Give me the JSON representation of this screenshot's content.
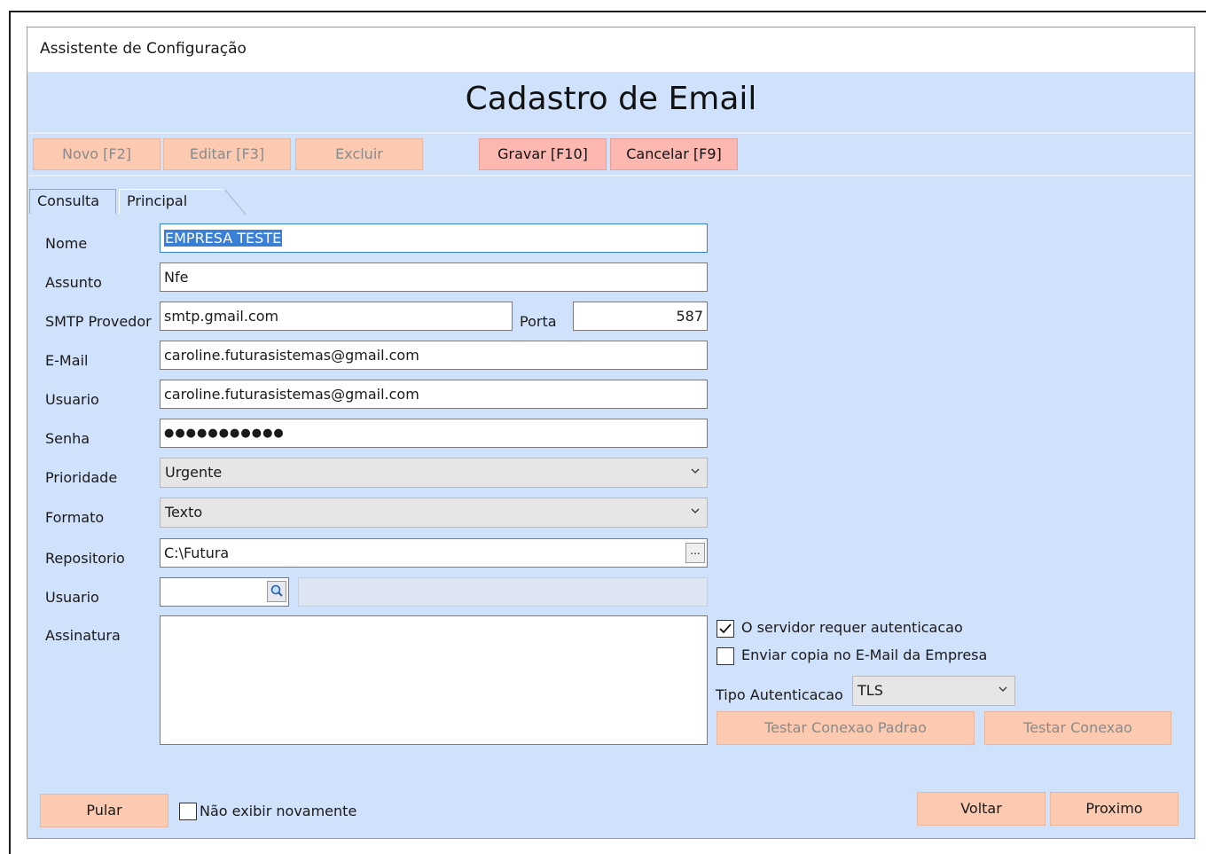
{
  "window": {
    "title": "Assistente de Configuração",
    "heading": "Cadastro de Email"
  },
  "toolbar": {
    "novo": "Novo [F2]",
    "editar": "Editar [F3]",
    "excluir": "Excluir",
    "gravar": "Gravar [F10]",
    "cancelar": "Cancelar [F9]"
  },
  "tabs": [
    "Consulta",
    "Principal"
  ],
  "form": {
    "nome": {
      "label": "Nome",
      "value": "EMPRESA TESTE"
    },
    "assunto": {
      "label": "Assunto",
      "value": "Nfe"
    },
    "smtp": {
      "label": "SMTP Provedor",
      "value": "smtp.gmail.com"
    },
    "porta": {
      "label": "Porta",
      "value": "587"
    },
    "email": {
      "label": "E-Mail",
      "value": "caroline.futurasistemas@gmail.com"
    },
    "usuario": {
      "label": "Usuario",
      "value": "caroline.futurasistemas@gmail.com"
    },
    "senha": {
      "label": "Senha",
      "value": "●●●●●●●●●●●"
    },
    "prioridade": {
      "label": "Prioridade",
      "value": "Urgente"
    },
    "formato": {
      "label": "Formato",
      "value": "Texto"
    },
    "repositorio": {
      "label": "Repositorio",
      "value": "C:\\Futura",
      "button": "..."
    },
    "usuario2": {
      "label": "Usuario",
      "value": ""
    },
    "assinatura": {
      "label": "Assinatura",
      "value": ""
    }
  },
  "options": {
    "autenticacao": {
      "label": "O servidor requer autenticacao",
      "checked": true
    },
    "copia": {
      "label": "Enviar copia no E-Mail da Empresa",
      "checked": false
    },
    "tipo_label": "Tipo Autenticacao",
    "tipo_value": "TLS",
    "testar_padrao": "Testar Conexao Padrao",
    "testar": "Testar Conexao"
  },
  "footer": {
    "pular": "Pular",
    "nao_exibir": "Não exibir novamente",
    "voltar": "Voltar",
    "proximo": "Proximo"
  }
}
